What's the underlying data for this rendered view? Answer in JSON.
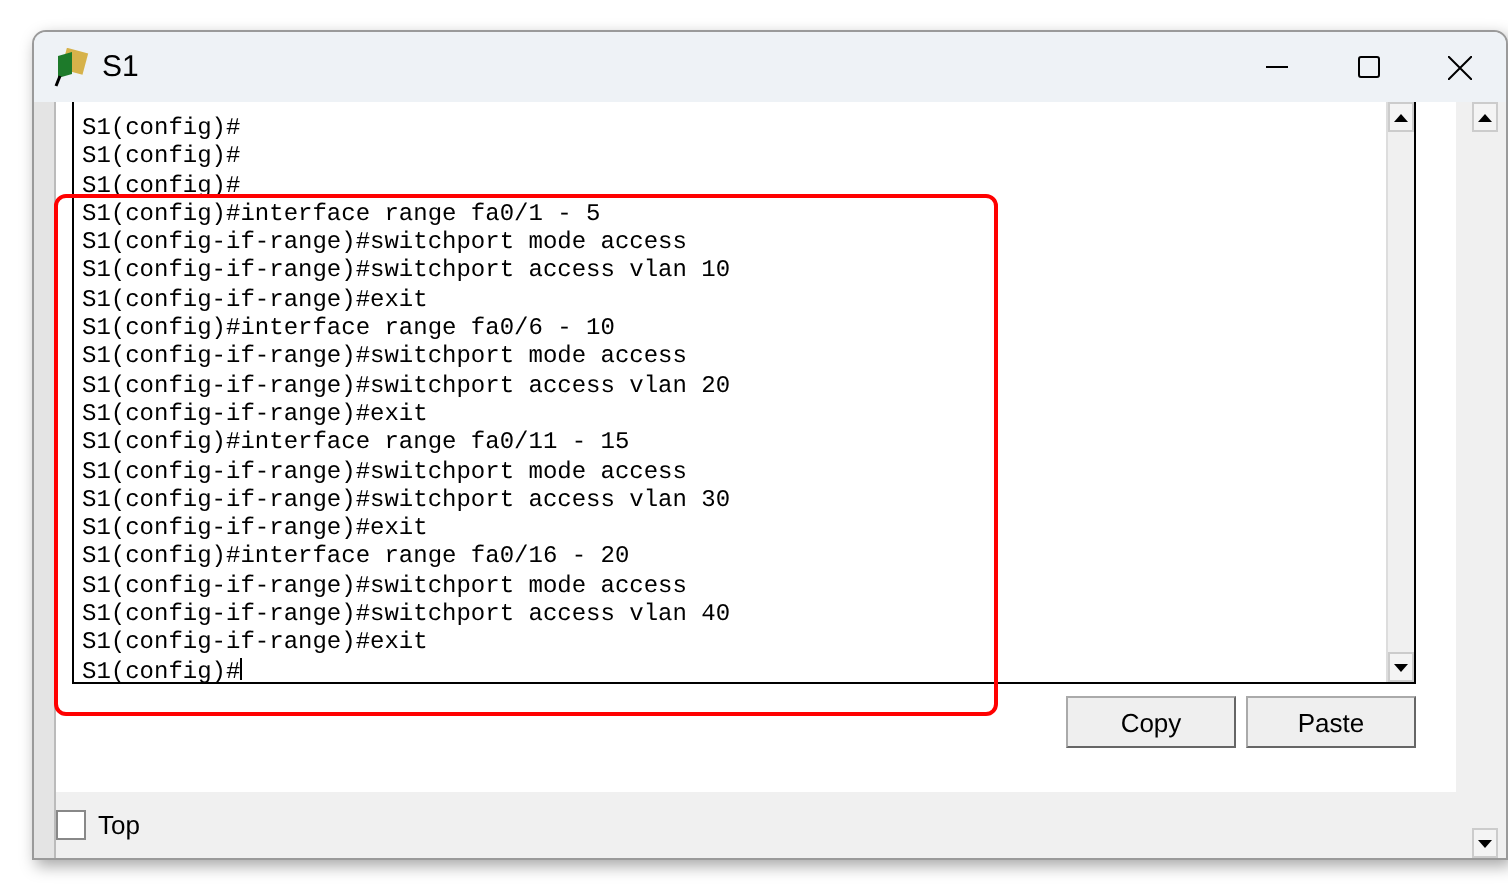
{
  "window": {
    "title": "S1"
  },
  "terminal": {
    "lines": [
      "S1(config)#",
      "S1(config)#",
      "S1(config)#",
      "S1(config)#interface range fa0/1 - 5",
      "S1(config-if-range)#switchport mode access",
      "S1(config-if-range)#switchport access vlan 10",
      "S1(config-if-range)#exit",
      "S1(config)#interface range fa0/6 - 10",
      "S1(config-if-range)#switchport mode access",
      "S1(config-if-range)#switchport access vlan 20",
      "S1(config-if-range)#exit",
      "S1(config)#interface range fa0/11 - 15",
      "S1(config-if-range)#switchport mode access",
      "S1(config-if-range)#switchport access vlan 30",
      "S1(config-if-range)#exit",
      "S1(config)#interface range fa0/16 - 20",
      "S1(config-if-range)#switchport mode access",
      "S1(config-if-range)#switchport access vlan 40",
      "S1(config-if-range)#exit",
      "S1(config)#"
    ]
  },
  "buttons": [
    "Copy",
    "Paste"
  ],
  "top_checkbox": {
    "label": "Top",
    "checked": false
  }
}
